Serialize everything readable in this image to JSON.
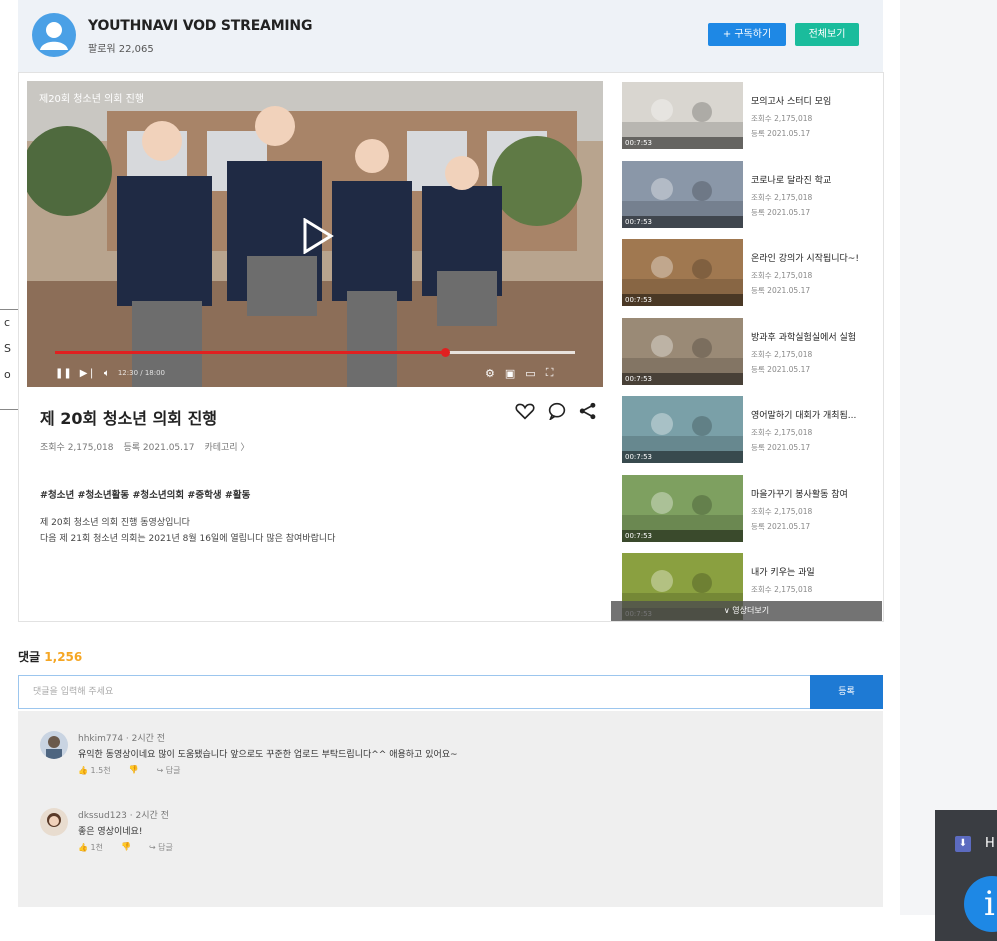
{
  "side_tab": {
    "lines": [
      "c",
      "S",
      "o"
    ]
  },
  "channel": {
    "name": "YOUTHNAVI VOD STREAMING",
    "followers": "팔로워 22,065",
    "subscribe_label": "+ 구독하기",
    "view_all_label": "전체보기"
  },
  "player": {
    "overlay_title": "제20회 청소년 의회 진행",
    "time": "12:30 / 18:00",
    "progress": 0.75
  },
  "video": {
    "title": "제 20회 청소년 의회 진행",
    "views": "조회수 2,175,018",
    "date": "등록 2021.05.17",
    "category": "카테고리 〉",
    "tags": "#청소년 #청소년활동 #청소년의회 #중학생 #활동",
    "desc_line1": "제 20회 청소년 의회 진행 동영상입니다",
    "desc_line2": "다음 제 21회 청소년 의회는 2021년 8월 16일에 열립니다 많은 참여바랍니다"
  },
  "playlist": [
    {
      "title": "모의고사 스터디 모임",
      "views": "조회수 2,175,018",
      "date": "등록 2021.05.17",
      "duration": "00:7:53",
      "color": "#d9d6d0"
    },
    {
      "title": "코로나로 달라진 학교",
      "views": "조회수 2,175,018",
      "date": "등록 2021.05.17",
      "duration": "00:7:53",
      "color": "#8a97a8"
    },
    {
      "title": "온라인 강의가 시작됩니다~!",
      "views": "조회수 2,175,018",
      "date": "등록 2021.05.17",
      "duration": "00:7:53",
      "color": "#a07850"
    },
    {
      "title": "방과후 과학실험실에서 실험",
      "views": "조회수 2,175,018",
      "date": "등록 2021.05.17",
      "duration": "00:7:53",
      "color": "#9a8a76"
    },
    {
      "title": "영어말하기 대회가 개최됨...",
      "views": "조회수 2,175,018",
      "date": "등록 2021.05.17",
      "duration": "00:7:53",
      "color": "#7aa0a8"
    },
    {
      "title": "마을가꾸기 봉사활동 참여",
      "views": "조회수 2,175,018",
      "date": "등록 2021.05.17",
      "duration": "00:7:53",
      "color": "#7ea060"
    },
    {
      "title": "내가 키우는 과일",
      "views": "조회수 2,175,018",
      "date": "",
      "duration": "00:7:53",
      "color": "#8aa040"
    }
  ],
  "more_label": "∨ 영상더보기",
  "comments_section": {
    "label": "댓글",
    "count": "1,256",
    "placeholder": "댓글을 입력해 주세요",
    "submit_label": "등록"
  },
  "comments": [
    {
      "user": "hhkim774 · 2시간 전",
      "text": "유익한 동영상이네요 많이 도움됐습니다 앞으로도 꾸준한 업로드 부탁드립니다^^ 애용하고 있어요~",
      "likes": "👍 1.5천",
      "dislike": "👎",
      "reply": "↪ 답글"
    },
    {
      "user": "dkssud123 · 2시간 전",
      "text": "좋은 영상이네요!",
      "likes": "👍 1천",
      "dislike": "👎",
      "reply": "↪ 답글"
    }
  ],
  "toast": {
    "icon_label": "⬇",
    "text": "H",
    "bubble": "i"
  }
}
